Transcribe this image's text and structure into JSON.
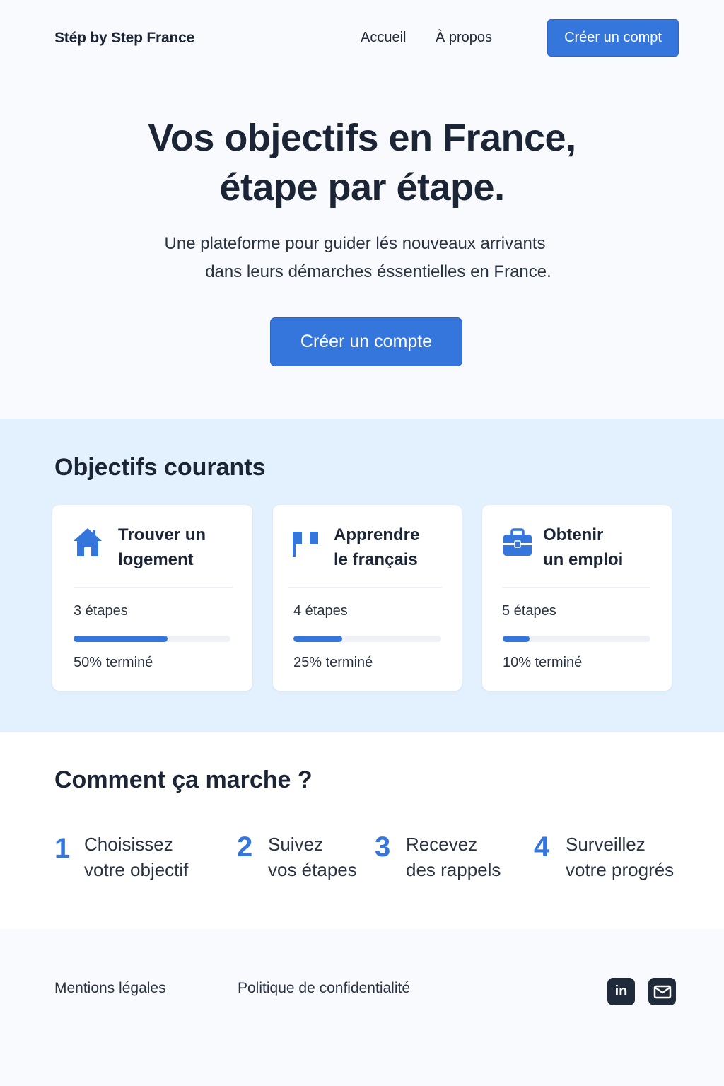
{
  "header": {
    "brand": "Stép by Step France",
    "nav": [
      {
        "label": "Accueil"
      },
      {
        "label": "À propos"
      }
    ],
    "cta_label": "Créer un compt"
  },
  "hero": {
    "title_line1": "Vos objectifs en France,",
    "title_line2": "étape par étape.",
    "subtitle_line1": "Une  plateforme pour guider lés nouveaux arrivants",
    "subtitle_line2": "dans leurs démarches éssentielles en France.",
    "cta_label": "Créer un compte"
  },
  "objectives": {
    "title": "Objectifs courants",
    "cards": [
      {
        "icon": "house-icon",
        "title_line1": "Trouver un",
        "title_line2": "logement",
        "steps": "3 étapes",
        "progress": 0.5,
        "done": "50% terminé"
      },
      {
        "icon": "flag-icon",
        "title_line1": "Apprendre",
        "title_line2": "le français",
        "steps": "4 étapes",
        "progress": 0.25,
        "done": "25% terminé"
      },
      {
        "icon": "briefcase-icon",
        "title_line1": "Obtenir",
        "title_line2": "un emploi",
        "steps": "5 étapes",
        "progress": 0.1,
        "done": "10% terminé"
      }
    ]
  },
  "how": {
    "title": "Comment ça marche ?",
    "steps": [
      {
        "num": "1",
        "line1": "Choisissez",
        "line2": "votre objectif"
      },
      {
        "num": "2",
        "line1": "Suivez",
        "line2": "vos étapes"
      },
      {
        "num": "3",
        "line1": "Recevez",
        "line2": "des rappels"
      },
      {
        "num": "4",
        "line1": "Surveillez",
        "line2": "votre progrés"
      }
    ]
  },
  "footer": {
    "links": [
      {
        "label": "Mentions légales"
      },
      {
        "label": "Politique de confidentialité"
      }
    ],
    "social": [
      {
        "icon": "linkedin-icon",
        "text": "in"
      },
      {
        "icon": "mail-icon"
      }
    ]
  },
  "colors": {
    "accent": "#3476db",
    "band": "#e3f0fd",
    "text": "#1b2535"
  }
}
